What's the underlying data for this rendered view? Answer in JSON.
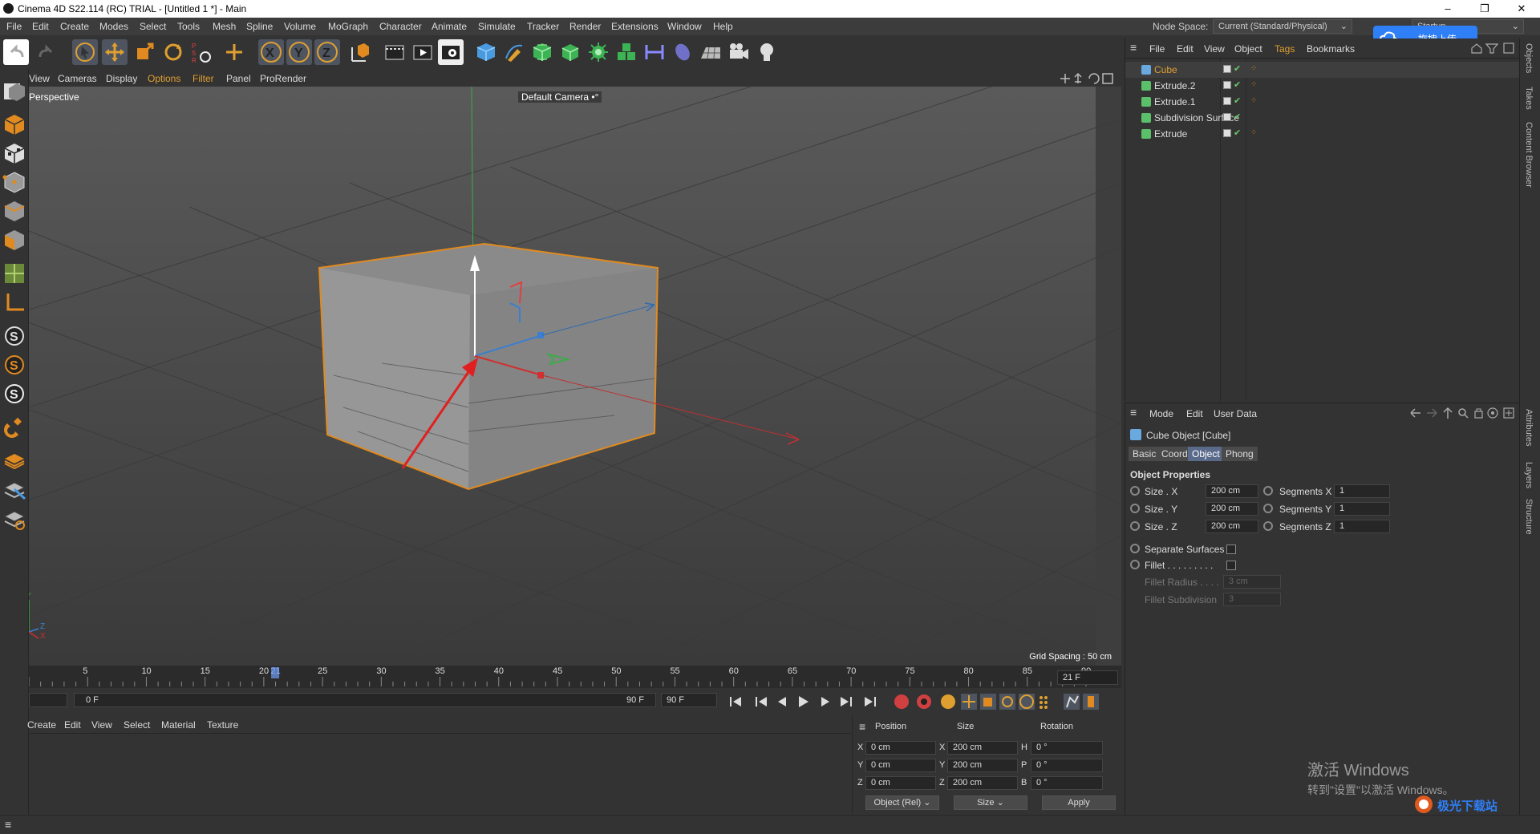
{
  "window": {
    "title": "Cinema 4D S22.114 (RC) TRIAL - [Untitled 1 *] - Main",
    "minimize": "–",
    "maximize": "❐",
    "close": "✕"
  },
  "menubar": {
    "items": [
      "File",
      "Edit",
      "Create",
      "Modes",
      "Select",
      "Tools",
      "Mesh",
      "Spline",
      "Volume",
      "MoGraph",
      "Character",
      "Animate",
      "Simulate",
      "Tracker",
      "Render",
      "Extensions",
      "Window",
      "Help"
    ],
    "node_space_label": "Node Space:",
    "node_space_value": "Current (Standard/Physical)",
    "layout_value": "Startup"
  },
  "cloud_button": {
    "label": "拖拽上传"
  },
  "viewport": {
    "menu": [
      "View",
      "Cameras",
      "Display",
      "Options",
      "Filter",
      "Panel",
      "ProRender"
    ],
    "projection": "Perspective",
    "camera": "Default Camera",
    "camera_icon": "•°",
    "grid_spacing": "Grid Spacing : 50 cm",
    "axis_labels": {
      "y": "Y",
      "z": "Z",
      "x": "X"
    }
  },
  "timeline": {
    "ticks": [
      "5",
      "10",
      "15",
      "20",
      "21",
      "25",
      "30",
      "35",
      "40",
      "45",
      "50",
      "55",
      "60",
      "65",
      "70",
      "75",
      "80",
      "85",
      "90"
    ],
    "current_frame": "21 F",
    "start_frame": "0 F",
    "range_start": "0 F",
    "range_end": "90 F",
    "end_frame": "90 F",
    "playhead_fraction": 0.233
  },
  "materials": {
    "menu": [
      "Create",
      "Edit",
      "View",
      "Select",
      "Material",
      "Texture"
    ]
  },
  "coordinates": {
    "headers": [
      "Position",
      "Size",
      "Rotation"
    ],
    "rows": [
      {
        "pl": "X",
        "pv": "0 cm",
        "sl": "X",
        "sv": "200 cm",
        "rl": "H",
        "rv": "0 °"
      },
      {
        "pl": "Y",
        "pv": "0 cm",
        "sl": "Y",
        "sv": "200 cm",
        "rl": "P",
        "rv": "0 °"
      },
      {
        "pl": "Z",
        "pv": "0 cm",
        "sl": "Z",
        "sv": "200 cm",
        "rl": "B",
        "rv": "0 °"
      }
    ],
    "mode_select": "Object (Rel)",
    "size_select": "Size",
    "apply": "Apply"
  },
  "object_manager": {
    "menu": [
      "File",
      "Edit",
      "View",
      "Object",
      "Tags",
      "Bookmarks"
    ],
    "objects": [
      {
        "name": "Cube",
        "selected": true,
        "color": "#6aa8e0"
      },
      {
        "name": "Extrude.2",
        "selected": false,
        "color": "#5cc06a"
      },
      {
        "name": "Extrude.1",
        "selected": false,
        "color": "#5cc06a"
      },
      {
        "name": "Subdivision Surface",
        "selected": false,
        "color": "#5cc06a"
      },
      {
        "name": "Extrude",
        "selected": false,
        "color": "#5cc06a"
      }
    ]
  },
  "attributes": {
    "menu": [
      "Mode",
      "Edit",
      "User Data"
    ],
    "object_title": "Cube Object [Cube]",
    "tabs": [
      "Basic",
      "Coord.",
      "Object",
      "Phong"
    ],
    "active_tab": "Object",
    "section": "Object Properties",
    "size_x_label": "Size . X",
    "size_x": "200 cm",
    "size_y_label": "Size . Y",
    "size_y": "200 cm",
    "size_z_label": "Size . Z",
    "size_z": "200 cm",
    "seg_x_label": "Segments X",
    "seg_x": "1",
    "seg_y_label": "Segments Y",
    "seg_y": "1",
    "seg_z_label": "Segments Z",
    "seg_z": "1",
    "separate_label": "Separate Surfaces",
    "fillet_label": "Fillet . . . . . . . . .",
    "fillet_radius_label": "Fillet Radius . . . .",
    "fillet_radius": "3 cm",
    "fillet_sub_label": "Fillet Subdivision",
    "fillet_sub": "3"
  },
  "side_tabs": [
    "Objects",
    "Takes",
    "Content Browser",
    "Attributes",
    "Layers",
    "Structure"
  ],
  "windows_activation": {
    "line1": "激活 Windows",
    "line2": "转到\"设置\"以激活 Windows。"
  },
  "watermark": "极光下载站"
}
